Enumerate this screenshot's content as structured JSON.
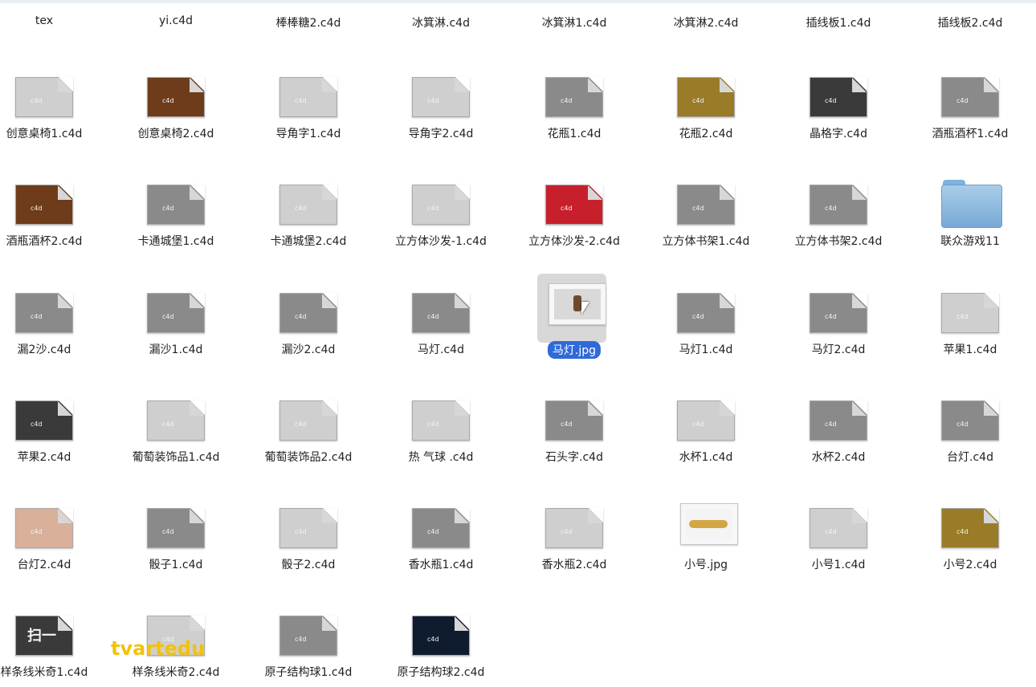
{
  "top_row_labels": [
    "tex",
    "yi.c4d",
    "棒棒糖2.c4d",
    "冰箕淋.c4d",
    "冰箕淋1.c4d",
    "冰箕淋2.c4d",
    "插线板1.c4d",
    "插线板2.c4d"
  ],
  "files": [
    {
      "name": "创意桌椅1.c4d",
      "kind": "c4d",
      "tone": "light"
    },
    {
      "name": "创意桌椅2.c4d",
      "kind": "c4d",
      "tone": "brown"
    },
    {
      "name": "导角字1.c4d",
      "kind": "c4d",
      "tone": "light"
    },
    {
      "name": "导角字2.c4d",
      "kind": "c4d",
      "tone": "light"
    },
    {
      "name": "花瓶1.c4d",
      "kind": "c4d",
      "tone": "mid"
    },
    {
      "name": "花瓶2.c4d",
      "kind": "c4d",
      "tone": "gold"
    },
    {
      "name": "晶格字.c4d",
      "kind": "c4d",
      "tone": "dark"
    },
    {
      "name": "酒瓶酒杯1.c4d",
      "kind": "c4d",
      "tone": "mid"
    },
    {
      "name": "酒瓶酒杯2.c4d",
      "kind": "c4d",
      "tone": "brown"
    },
    {
      "name": "卡通城堡1.c4d",
      "kind": "c4d",
      "tone": "mid"
    },
    {
      "name": "卡通城堡2.c4d",
      "kind": "c4d",
      "tone": "light"
    },
    {
      "name": "立方体沙发-1.c4d",
      "kind": "c4d",
      "tone": "light"
    },
    {
      "name": "立方体沙发-2.c4d",
      "kind": "c4d",
      "tone": "red"
    },
    {
      "name": "立方体书架1.c4d",
      "kind": "c4d",
      "tone": "mid"
    },
    {
      "name": "立方体书架2.c4d",
      "kind": "c4d",
      "tone": "mid"
    },
    {
      "name": "联众游戏11",
      "kind": "folder",
      "tone": "folder"
    },
    {
      "name": "漏2沙.c4d",
      "kind": "c4d",
      "tone": "mid"
    },
    {
      "name": "漏沙1.c4d",
      "kind": "c4d",
      "tone": "mid"
    },
    {
      "name": "漏沙2.c4d",
      "kind": "c4d",
      "tone": "mid"
    },
    {
      "name": "马灯.c4d",
      "kind": "c4d",
      "tone": "mid"
    },
    {
      "name": "马灯.jpg",
      "kind": "jpg-lantern",
      "tone": "image",
      "selected": true
    },
    {
      "name": "马灯1.c4d",
      "kind": "c4d",
      "tone": "mid"
    },
    {
      "name": "马灯2.c4d",
      "kind": "c4d",
      "tone": "mid"
    },
    {
      "name": "苹果1.c4d",
      "kind": "c4d",
      "tone": "light"
    },
    {
      "name": "苹果2.c4d",
      "kind": "c4d",
      "tone": "dark"
    },
    {
      "name": "葡萄装饰品1.c4d",
      "kind": "c4d",
      "tone": "light"
    },
    {
      "name": "葡萄装饰品2.c4d",
      "kind": "c4d",
      "tone": "light"
    },
    {
      "name": "热 气球 .c4d",
      "kind": "c4d",
      "tone": "light"
    },
    {
      "name": "石头字.c4d",
      "kind": "c4d",
      "tone": "mid"
    },
    {
      "name": "水杯1.c4d",
      "kind": "c4d",
      "tone": "light"
    },
    {
      "name": "水杯2.c4d",
      "kind": "c4d",
      "tone": "mid"
    },
    {
      "name": "台灯.c4d",
      "kind": "c4d",
      "tone": "mid"
    },
    {
      "name": "台灯2.c4d",
      "kind": "c4d",
      "tone": "peach"
    },
    {
      "name": "骰子1.c4d",
      "kind": "c4d",
      "tone": "mid"
    },
    {
      "name": "骰子2.c4d",
      "kind": "c4d",
      "tone": "light"
    },
    {
      "name": "香水瓶1.c4d",
      "kind": "c4d",
      "tone": "mid"
    },
    {
      "name": "香水瓶2.c4d",
      "kind": "c4d",
      "tone": "light"
    },
    {
      "name": "小号.jpg",
      "kind": "jpg-trumpet",
      "tone": "image"
    },
    {
      "name": "小号1.c4d",
      "kind": "c4d",
      "tone": "light"
    },
    {
      "name": "小号2.c4d",
      "kind": "c4d",
      "tone": "gold"
    },
    {
      "name": "样条线米奇1.c4d",
      "kind": "c4d",
      "tone": "dark",
      "badge": "扫一"
    },
    {
      "name": "样条线米奇2.c4d",
      "kind": "c4d",
      "tone": "light"
    },
    {
      "name": "原子结构球1.c4d",
      "kind": "c4d",
      "tone": "mid"
    },
    {
      "name": "原子结构球2.c4d",
      "kind": "c4d",
      "tone": "navy"
    }
  ],
  "c4d_ext": "c4d",
  "watermark": "tvartedu"
}
